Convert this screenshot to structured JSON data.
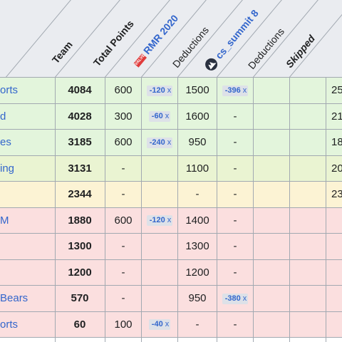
{
  "header": {
    "team": "Team",
    "total_points": "Total Points",
    "rmr_badge": "VALVE",
    "rmr": "RMR 2020",
    "deductions_1": "Deductions",
    "cs_summit": "cs_summit 8",
    "deductions_2": "Deductions",
    "skipped": "Skipped"
  },
  "rows": [
    {
      "team": "orts",
      "total": "4084",
      "rmr": "600",
      "rmr_ded": "-120",
      "cs": "1500",
      "cs_ded": "-396",
      "col7": "-",
      "last": "25",
      "bg": "#e3f5dc"
    },
    {
      "team": "d",
      "total": "4028",
      "rmr": "300",
      "rmr_ded": "-60",
      "cs": "1600",
      "cs_ded": "",
      "col7": "-",
      "last": "21",
      "bg": "#e3f5dc"
    },
    {
      "team": "es",
      "total": "3185",
      "rmr": "600",
      "rmr_ded": "-240",
      "cs": "950",
      "cs_ded": "",
      "col7": "-",
      "last": "18",
      "bg": "#e3f5dc"
    },
    {
      "team": "ing",
      "total": "3131",
      "rmr": "-",
      "rmr_ded": "",
      "cs": "1100",
      "cs_ded": "",
      "col7": "-",
      "last": "20",
      "bg": "#eaf4d2"
    },
    {
      "team": "",
      "total": "2344",
      "rmr": "-",
      "rmr_ded": "",
      "cs": "-",
      "cs_ded": "",
      "col7": "-",
      "last": "23",
      "bg": "#fcf3d4"
    },
    {
      "team": "M",
      "total": "1880",
      "rmr": "600",
      "rmr_ded": "-120",
      "cs": "1400",
      "cs_ded": "",
      "col7": "-",
      "last": "",
      "bg": "#fbdfdf"
    },
    {
      "team": "",
      "total": "1300",
      "rmr": "-",
      "rmr_ded": "",
      "cs": "1300",
      "cs_ded": "",
      "col7": "-",
      "last": "",
      "bg": "#fbdfdf"
    },
    {
      "team": "",
      "total": "1200",
      "rmr": "-",
      "rmr_ded": "",
      "cs": "1200",
      "cs_ded": "",
      "col7": "-",
      "last": "",
      "bg": "#fbdfdf"
    },
    {
      "team": "Bears",
      "total": "570",
      "rmr": "-",
      "rmr_ded": "",
      "cs": "950",
      "cs_ded": "-380",
      "col7": "-",
      "last": "",
      "bg": "#fbdfdf"
    },
    {
      "team": "orts",
      "total": "60",
      "rmr": "100",
      "rmr_ded": "-40",
      "cs": "-",
      "cs_ded": "",
      "col7": "-",
      "last": "",
      "bg": "#fbdfdf"
    }
  ],
  "deduction_close": "x"
}
